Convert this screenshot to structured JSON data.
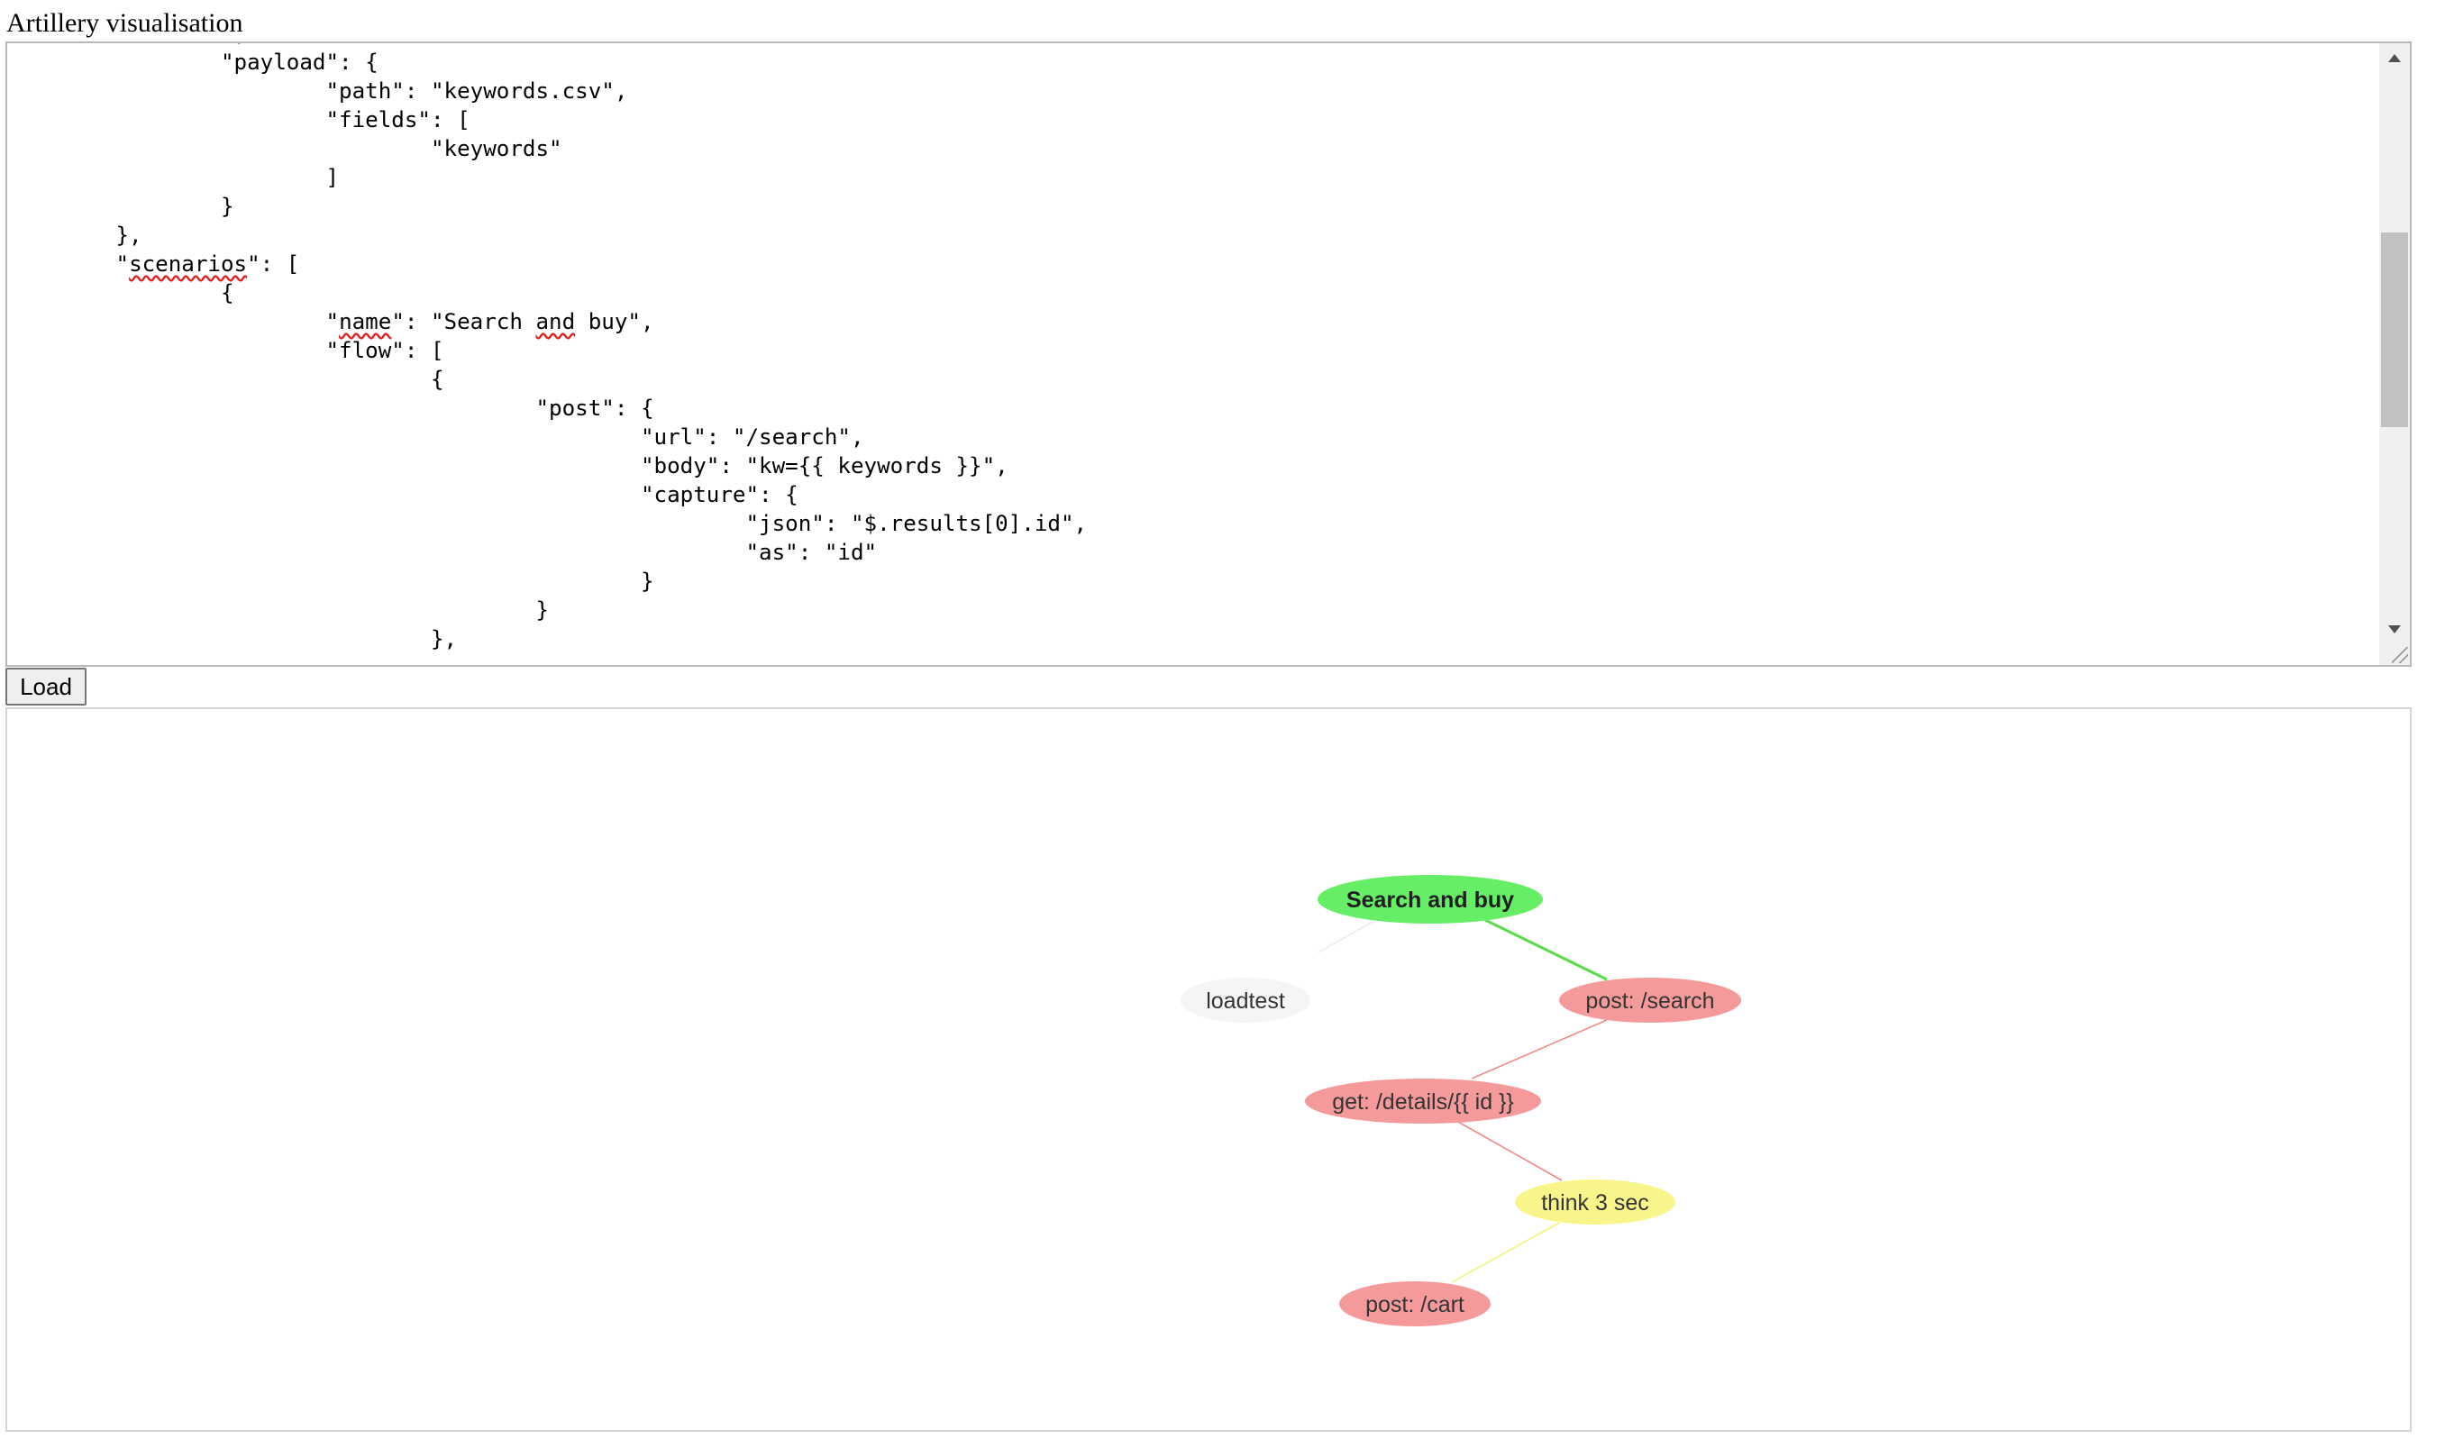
{
  "page": {
    "title": "Artillery visualisation"
  },
  "editor": {
    "lines": [
      [
        {
          "t": "\t\t],"
        }
      ],
      [
        {
          "t": "\t\t\"payload\": {"
        }
      ],
      [
        {
          "t": "\t\t\t\"path\": \"keywords.csv\","
        }
      ],
      [
        {
          "t": "\t\t\t\"fields\": ["
        }
      ],
      [
        {
          "t": "\t\t\t\t\"keywords\""
        }
      ],
      [
        {
          "t": "\t\t\t]"
        }
      ],
      [
        {
          "t": "\t\t}"
        }
      ],
      [
        {
          "t": "\t},"
        }
      ],
      [
        {
          "t": "\t\""
        },
        {
          "t": "scenarios",
          "sq": true
        },
        {
          "t": "\": ["
        }
      ],
      [
        {
          "t": "\t\t{"
        }
      ],
      [
        {
          "t": "\t\t\t\""
        },
        {
          "t": "name",
          "sq": true
        },
        {
          "t": "\": \"Search "
        },
        {
          "t": "and",
          "sq": true
        },
        {
          "t": " buy\","
        }
      ],
      [
        {
          "t": "\t\t\t\"flow\": ["
        }
      ],
      [
        {
          "t": "\t\t\t\t{"
        }
      ],
      [
        {
          "t": "\t\t\t\t\t\"post\": {"
        }
      ],
      [
        {
          "t": "\t\t\t\t\t\t\"url\": \"/search\","
        }
      ],
      [
        {
          "t": "\t\t\t\t\t\t\"body\": \"kw={{ keywords }}\","
        }
      ],
      [
        {
          "t": "\t\t\t\t\t\t\"capture\": {"
        }
      ],
      [
        {
          "t": "\t\t\t\t\t\t\t\"json\": \"$.results[0].id\","
        }
      ],
      [
        {
          "t": "\t\t\t\t\t\t\t\"as\": \"id\""
        }
      ],
      [
        {
          "t": "\t\t\t\t\t\t}"
        }
      ],
      [
        {
          "t": "\t\t\t\t\t}"
        }
      ],
      [
        {
          "t": "\t\t\t\t},"
        }
      ]
    ]
  },
  "load_button": {
    "label": "Load"
  },
  "graph": {
    "nodes": [
      {
        "id": "scenario",
        "label": "Search and buy",
        "kind": "scenario",
        "color": "#66ee66"
      },
      {
        "id": "loadtest",
        "label": "loadtest",
        "kind": "root",
        "color": "#f5f5f5"
      },
      {
        "id": "post-search",
        "label": "post: /search",
        "kind": "request",
        "color": "#f59a9a"
      },
      {
        "id": "get-details",
        "label": "get: /details/{{ id }}",
        "kind": "request",
        "color": "#f59a9a"
      },
      {
        "id": "think",
        "label": "think 3 sec",
        "kind": "think",
        "color": "#f8f68a"
      },
      {
        "id": "post-cart",
        "label": "post: /cart",
        "kind": "request",
        "color": "#f59a9a"
      }
    ],
    "edges": [
      {
        "from": "scenario",
        "to": "loadtest",
        "color": "#eeeeee"
      },
      {
        "from": "scenario",
        "to": "post-search",
        "color": "#55dd44"
      },
      {
        "from": "post-search",
        "to": "get-details",
        "color": "#f08a8a"
      },
      {
        "from": "get-details",
        "to": "think",
        "color": "#f08a8a"
      },
      {
        "from": "think",
        "to": "post-cart",
        "color": "#f4f27a"
      }
    ]
  }
}
